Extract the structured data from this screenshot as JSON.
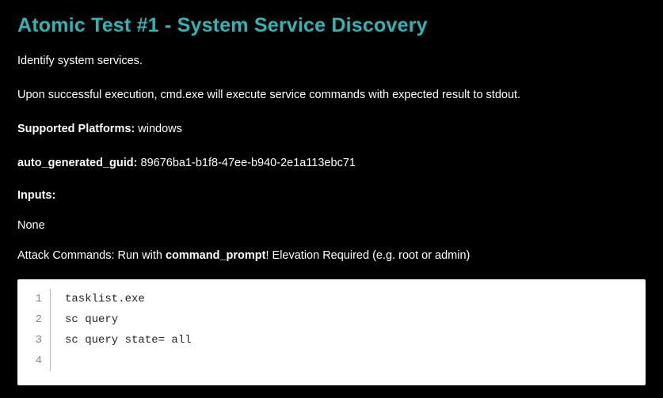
{
  "title": "Atomic Test #1 - System Service Discovery",
  "description": "Identify system services.",
  "execution_note": "Upon successful execution, cmd.exe will execute service commands with expected result to stdout.",
  "platforms_label": "Supported Platforms:",
  "platforms_value": "windows",
  "guid_label": "auto_generated_guid:",
  "guid_value": "89676ba1-b1f8-47ee-b940-2e1a113ebc71",
  "inputs_label": "Inputs:",
  "inputs_value": "None",
  "attack": {
    "prefix": "Attack Commands: Run with ",
    "command_name": "command_prompt",
    "suffix": "! Elevation Required (e.g. root or admin)"
  },
  "code": {
    "lines": [
      {
        "n": "1",
        "text": "tasklist.exe"
      },
      {
        "n": "2",
        "text": "sc query"
      },
      {
        "n": "3",
        "text": "sc query state= all"
      },
      {
        "n": "4",
        "text": ""
      }
    ]
  }
}
